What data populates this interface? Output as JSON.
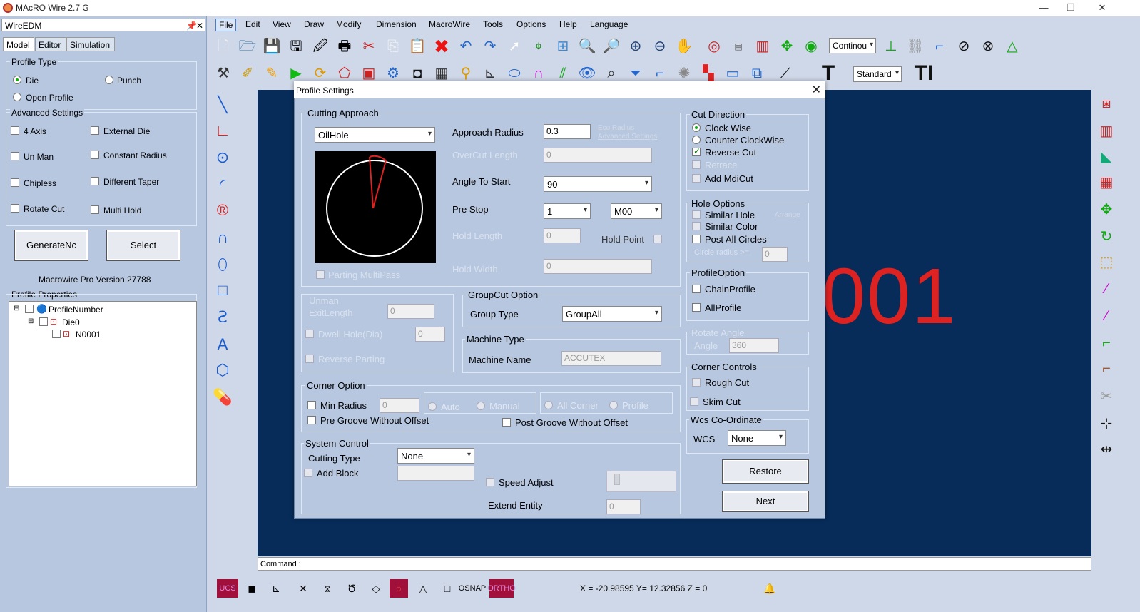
{
  "app": {
    "title": "MAcRO Wire 2.7 G"
  },
  "left": {
    "header": "WireEDM",
    "tabs": [
      "Model",
      "Editor",
      "Simulation"
    ],
    "profile_type": {
      "label": "Profile Type",
      "die": "Die",
      "punch": "Punch",
      "open": "Open Profile"
    },
    "advanced": {
      "label": "Advanced Settings",
      "items": [
        "4 Axis",
        "External Die",
        "Un Man",
        "Constant Radius",
        "Chipless",
        "Different Taper",
        "Rotate Cut",
        "Multi Hold"
      ]
    },
    "buttons": {
      "generate": "GenerateNc",
      "select": "Select"
    },
    "version": "Macrowire Pro Version 27788",
    "props": {
      "label": "Profile Properties",
      "root": "ProfileNumber",
      "die": "Die0",
      "child": "N0001"
    }
  },
  "menu": [
    "File",
    "Edit",
    "View",
    "Draw",
    "Modify",
    "Dimension",
    "MacroWire",
    "Tools",
    "Options",
    "Help",
    "Language"
  ],
  "toolbar": {
    "combo1": "Continou",
    "combo2": "Standard"
  },
  "canvas": {
    "text": "001",
    "command_label": "Command :"
  },
  "status": {
    "ucs": "UCS",
    "osnap": "OSNAP",
    "ortho": "ORTHO",
    "coords": "X = -20.98595  Y= 12.32856  Z = 0"
  },
  "dialog": {
    "title": "Profile Settings",
    "cutting": {
      "label": "Cutting Approach",
      "type": "OilHole",
      "approach_radius_label": "Approach Radius",
      "approach_radius": "0.3",
      "eco_radius": "Eco Radius",
      "adv_settings": "Advanced Settings",
      "overcut_label": "OverCut Length",
      "overcut": "0",
      "angle_label": "Angle To Start",
      "angle": "90",
      "prestop_label": "Pre Stop",
      "prestop": "1",
      "mcode": "M00",
      "hold_length_label": "Hold Length",
      "hold_length": "0",
      "hold_point": "Hold Point",
      "hold_width_label": "Hold Width",
      "hold_width": "0",
      "parting": "Parting MultiPass"
    },
    "unman": {
      "label1": "Unman",
      "label2": "ExitLength",
      "value": "0",
      "dwell": "Dwell Hole(Dia)",
      "dwell_value": "0",
      "reverse": "Reverse Parting"
    },
    "groupcut": {
      "label": "GroupCut Option",
      "type_label": "Group Type",
      "type": "GroupAll"
    },
    "machine": {
      "label": "Machine Type",
      "name_label": "Machine Name",
      "name": "ACCUTEX"
    },
    "corner": {
      "label": "Corner Option",
      "min_radius": "Min Radius",
      "min_value": "0",
      "auto": "Auto",
      "manual": "Manual",
      "all_corner": "All Corner",
      "profile": "Profile",
      "pre_groove": "Pre Groove Without Offset",
      "post_groove": "Post Groove Without Offset"
    },
    "system": {
      "label": "System Control",
      "cutting_type_label": "Cutting Type",
      "cutting_type": "None",
      "add_block": "Add Block",
      "speed": "Speed Adjust",
      "extend": "Extend Entity",
      "extend_value": "0"
    },
    "cut_direction": {
      "label": "Cut Direction",
      "cw": "Clock Wise",
      "ccw": "Counter ClockWise",
      "reverse": "Reverse Cut",
      "retrace": "Retrace",
      "mdicut": "Add MdiCut"
    },
    "hole": {
      "label": "Hole Options",
      "similar_hole": "Similar Hole",
      "arrange": "Arrange",
      "similar_color": "Similar Color",
      "post_all": "Post All Circles",
      "circle_radius": "Circle radius >=",
      "circle_value": "0"
    },
    "profile_option": {
      "label": "ProfileOption",
      "chain": "ChainProfile",
      "all": "AllProfile"
    },
    "rotate": {
      "label": "Rotate Angle",
      "angle_label": "Angle",
      "value": "360"
    },
    "corner_controls": {
      "label": "Corner Controls",
      "rough": "Rough Cut",
      "skim": "Skim Cut"
    },
    "wcs": {
      "label": "Wcs Co-Ordinate",
      "name": "WCS",
      "value": "None"
    },
    "buttons": {
      "restore": "Restore",
      "next": "Next"
    }
  }
}
